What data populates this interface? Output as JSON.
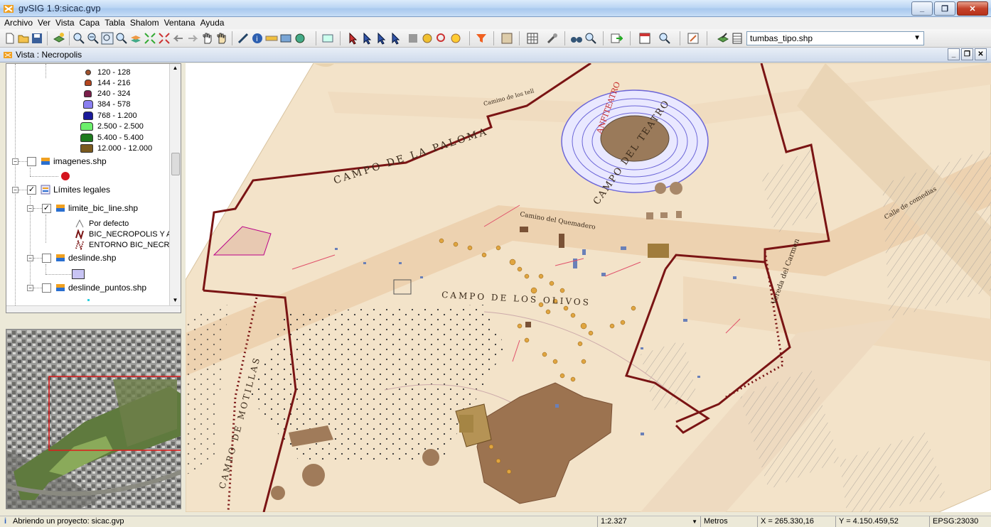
{
  "window": {
    "title": "gvSIG 1.9:sicac.gvp"
  },
  "menu": [
    "Archivo",
    "Ver",
    "Vista",
    "Capa",
    "Tabla",
    "Shalom",
    "Ventana",
    "Ayuda"
  ],
  "toolbar": {
    "layer_select_value": "tumbas_tipo.shp"
  },
  "view": {
    "title": "Vista : Necropolis"
  },
  "toc": {
    "legend": [
      {
        "label": "120 - 128",
        "color": "#a0522d"
      },
      {
        "label": "144 - 216",
        "color": "#b4461e"
      },
      {
        "label": "240 - 324",
        "color": "#7a1e4a"
      },
      {
        "label": "384 - 578",
        "color": "#8a7ff0"
      },
      {
        "label": "768 - 1.200",
        "color": "#1a1a9a"
      },
      {
        "label": "2.500 - 2.500",
        "color": "#6cf06c"
      },
      {
        "label": "5.400 - 5.400",
        "color": "#1e7a1e"
      },
      {
        "label": "12.000 - 12.000",
        "color": "#7a5a1e"
      }
    ],
    "layers": {
      "imagenes": "imagenes.shp",
      "limites": "Límites legales",
      "limite_bic": "limite_bic_line.shp",
      "por_defecto": "Por defecto",
      "bic_necropolis": "BIC_NECROPOLIS Y AN",
      "entorno": "ENTORNO BIC_NECRO",
      "deslinde": "deslinde.shp",
      "deslinde_puntos": "deslinde_puntos.shp"
    }
  },
  "map": {
    "labels": {
      "campo_paloma": "CAMPO DE LA PALOMA",
      "campo_olivos": "CAMPO DE LOS OLIVOS",
      "campo_teatro": "CAMPO DEL TEATRO",
      "camino_quemadero": "Camino del Quemadero",
      "calle_comedias": "Calle de comedias",
      "vereda_carmen": "Vereda del Carmen",
      "campo_motillas": "CAMPO DE MOTILLAS",
      "anfiteatro": "ANFITEATRO",
      "camino_top": "Camino de los tell"
    }
  },
  "status": {
    "message": "Abriendo un proyecto: sicac.gvp",
    "scale": "1:2.327",
    "units": "Metros",
    "x": "X = 265.330,16",
    "y": "Y = 4.150.459,52",
    "epsg": "EPSG:23030"
  }
}
